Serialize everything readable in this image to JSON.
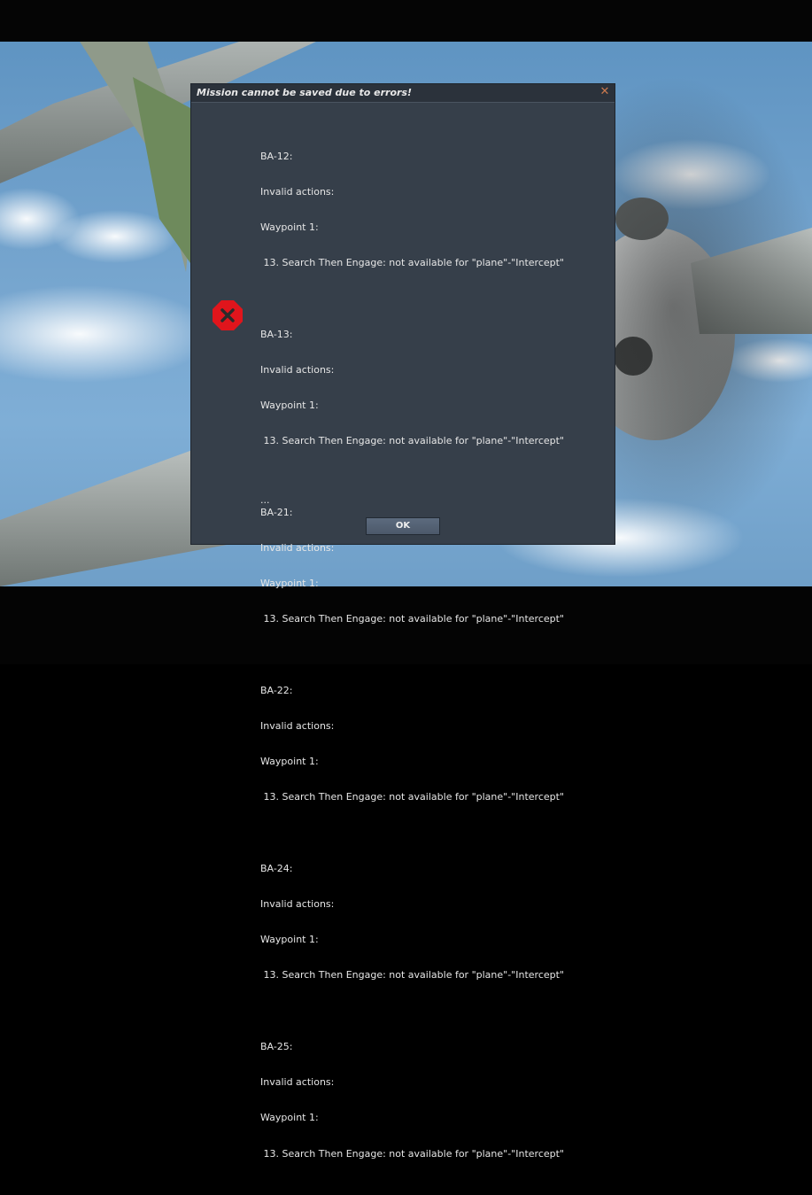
{
  "dialog": {
    "title": "Mission cannot be saved due to errors!",
    "close_icon": "close-icon",
    "error_icon": "error-x-icon",
    "messages": [
      {
        "unit": "BA-12:",
        "line1": "Invalid actions:",
        "line2": "Waypoint 1:",
        "line3": " 13. Search Then Engage: not available for \"plane\"-\"Intercept\""
      },
      {
        "unit": "BA-13:",
        "line1": "Invalid actions:",
        "line2": "Waypoint 1:",
        "line3": " 13. Search Then Engage: not available for \"plane\"-\"Intercept\""
      },
      {
        "unit": "BA-21:",
        "line1": "Invalid actions:",
        "line2": "Waypoint 1:",
        "line3": " 13. Search Then Engage: not available for \"plane\"-\"Intercept\""
      },
      {
        "unit": "BA-22:",
        "line1": "Invalid actions:",
        "line2": "Waypoint 1:",
        "line3": " 13. Search Then Engage: not available for \"plane\"-\"Intercept\""
      },
      {
        "unit": "BA-24:",
        "line1": "Invalid actions:",
        "line2": "Waypoint 1:",
        "line3": " 13. Search Then Engage: not available for \"plane\"-\"Intercept\""
      },
      {
        "unit": "BA-25:",
        "line1": "Invalid actions:",
        "line2": "Waypoint 1:",
        "line3": " 13. Search Then Engage: not available for \"plane\"-\"Intercept\""
      }
    ],
    "ellipsis": "...",
    "ok_label": "OK"
  },
  "colors": {
    "dialog_bg": "#363f4a",
    "titlebar_bg": "#2b323b",
    "error_red": "#e0151c",
    "close_orange": "#c9794e"
  }
}
